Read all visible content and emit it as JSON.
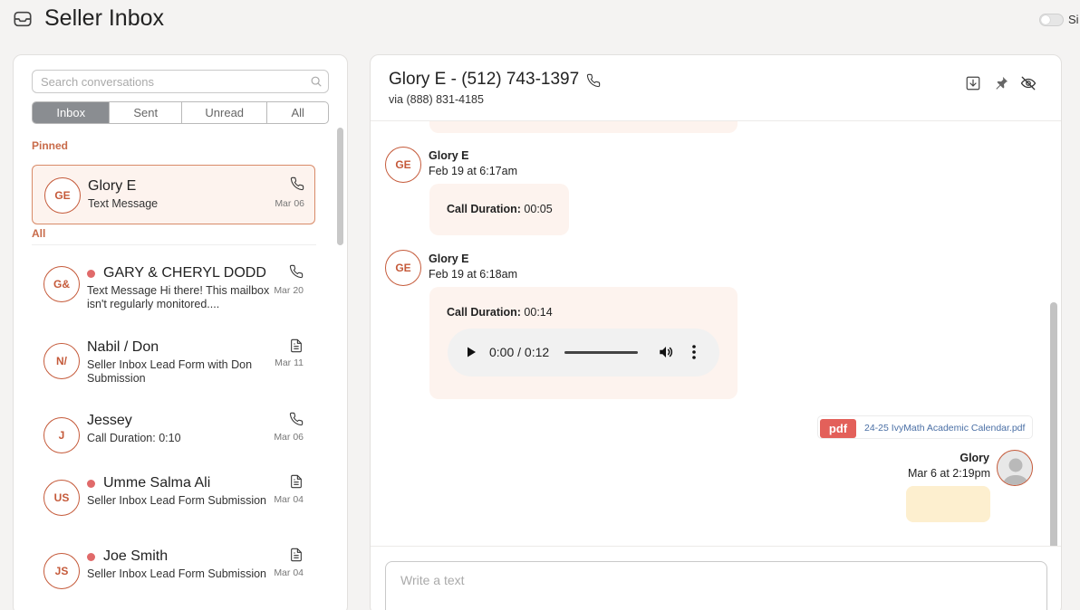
{
  "app": {
    "title": "Seller Inbox",
    "toggle_label": "Si"
  },
  "search": {
    "placeholder": "Search conversations"
  },
  "tabs": [
    {
      "label": "Inbox",
      "active": true
    },
    {
      "label": "Sent",
      "active": false
    },
    {
      "label": "Unread",
      "active": false
    },
    {
      "label": "All",
      "active": false
    }
  ],
  "sections": {
    "pinned": "Pinned",
    "all": "All"
  },
  "pinned": [
    {
      "initials": "GE",
      "name": "Glory E",
      "snippet": "Text Message",
      "date": "Mar 06",
      "icon": "phone-icon",
      "unread": false
    }
  ],
  "conversations": [
    {
      "initials": "G&",
      "name": "GARY & CHERYL DODD",
      "snippet": "Text Message Hi there! This mailbox isn't regularly monitored....",
      "date": "Mar 20",
      "icon": "phone-icon",
      "unread": true
    },
    {
      "initials": "N/",
      "name": "Nabil / Don",
      "snippet": "Seller Inbox Lead Form with Don Submission",
      "date": "Mar 11",
      "icon": "document-icon",
      "unread": false
    },
    {
      "initials": "J",
      "name": "Jessey",
      "snippet": "Call Duration: 0:10",
      "date": "Mar 06",
      "icon": "phone-icon",
      "unread": false
    },
    {
      "initials": "US",
      "name": "Umme Salma Ali",
      "snippet": "Seller Inbox Lead Form Submission",
      "date": "Mar 04",
      "icon": "document-icon",
      "unread": true
    },
    {
      "initials": "JS",
      "name": "Joe Smith",
      "snippet": "Seller Inbox Lead Form Submission",
      "date": "Mar 04",
      "icon": "document-icon",
      "unread": true
    }
  ],
  "thread": {
    "title": "Glory E - (512) 743-1397",
    "via": "via (888) 831-4185",
    "messages": [
      {
        "initials": "GE",
        "sender": "Glory E",
        "time": "Feb 19 at 6:17am",
        "label": "Call Duration:",
        "value": " 00:05"
      },
      {
        "initials": "GE",
        "sender": "Glory E",
        "time": "Feb 19 at 6:18am",
        "label": "Call Duration:",
        "value": " 00:14",
        "audio": {
          "time": "0:00 / 0:12",
          "progress": 0
        }
      }
    ],
    "attachment": {
      "badge": "pdf",
      "filename": "24-25 IvyMath Academic Calendar.pdf"
    },
    "outgoing": {
      "sender": "Glory",
      "time": "Mar 6 at 2:19pm"
    }
  },
  "composer": {
    "placeholder": "Write a text"
  },
  "colors": {
    "accent": "#c55a3a",
    "pinned_bg": "#fdf3ee",
    "unread_dot": "#e06a6a",
    "tab_active": "#8a8d91",
    "pdf_badge": "#e3605a",
    "outgoing_bubble": "#fdefcf"
  }
}
